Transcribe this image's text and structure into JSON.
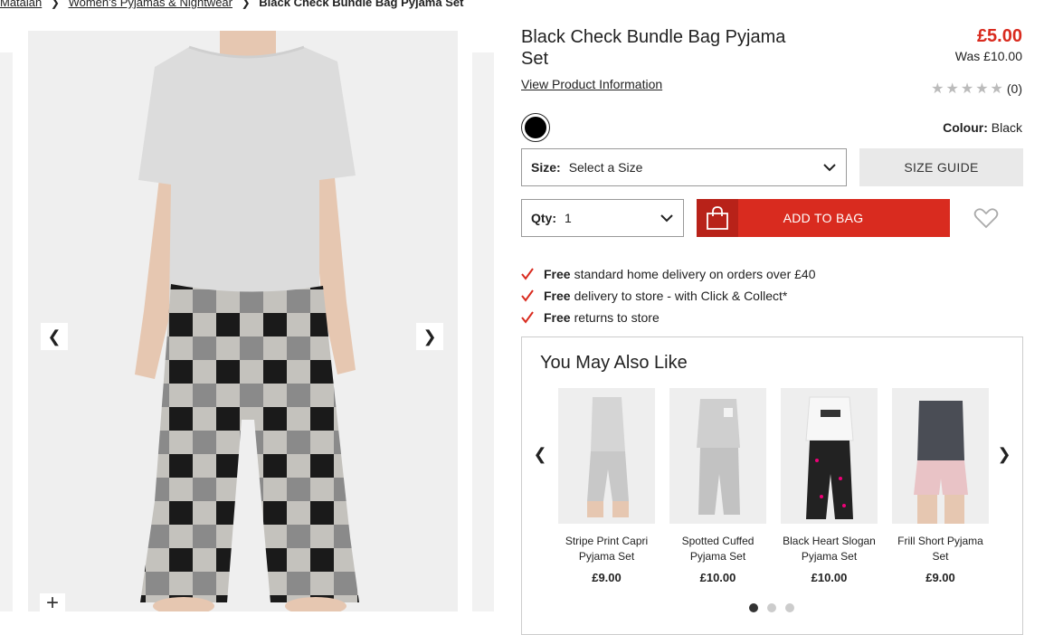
{
  "breadcrumb": {
    "items": [
      {
        "label": "Matalan"
      },
      {
        "label": "Women's Pyjamas & Nightwear"
      }
    ],
    "current": "Black Check Bundle Bag Pyjama Set"
  },
  "product": {
    "title": "Black Check Bundle Bag Pyjama Set",
    "view_info_link": "View Product Information",
    "price": "£5.00",
    "was_price": "Was £10.00",
    "rating_stars": 0,
    "rating_count": "(0)",
    "colour_label": "Colour:",
    "colour_value": "Black",
    "swatch_color": "#000000"
  },
  "size_select": {
    "label": "Size:",
    "value": "Select a Size"
  },
  "qty_select": {
    "label": "Qty:",
    "value": "1"
  },
  "size_guide_label": "SIZE GUIDE",
  "add_to_bag_label": "ADD TO BAG",
  "benefits": [
    {
      "bold": "Free",
      "text": "standard home delivery on orders over £40"
    },
    {
      "bold": "Free",
      "text": "delivery to store - with Click & Collect*"
    },
    {
      "bold": "Free",
      "text": "returns to store"
    }
  ],
  "recommendations": {
    "title": "You May Also Like",
    "items": [
      {
        "name": "Stripe Print Capri Pyjama Set",
        "price": "£9.00"
      },
      {
        "name": "Spotted Cuffed Pyjama Set",
        "price": "£10.00"
      },
      {
        "name": "Black Heart Slogan Pyjama Set",
        "price": "£10.00"
      },
      {
        "name": "Frill Short Pyjama Set",
        "price": "£9.00"
      }
    ],
    "page_count": 3,
    "active_page": 1
  },
  "colors": {
    "accent_red": "#d92b1f",
    "text": "#222222",
    "star_empty": "#bbbbbb",
    "size_guide_bg": "#e9e9e9"
  },
  "icons": {
    "gallery_prev": "chevron-left-icon",
    "gallery_next": "chevron-right-icon",
    "zoom": "plus-icon",
    "select": "chevron-down-icon",
    "bag": "shopping-bag-icon",
    "wishlist": "heart-icon",
    "benefit": "tick-icon"
  }
}
